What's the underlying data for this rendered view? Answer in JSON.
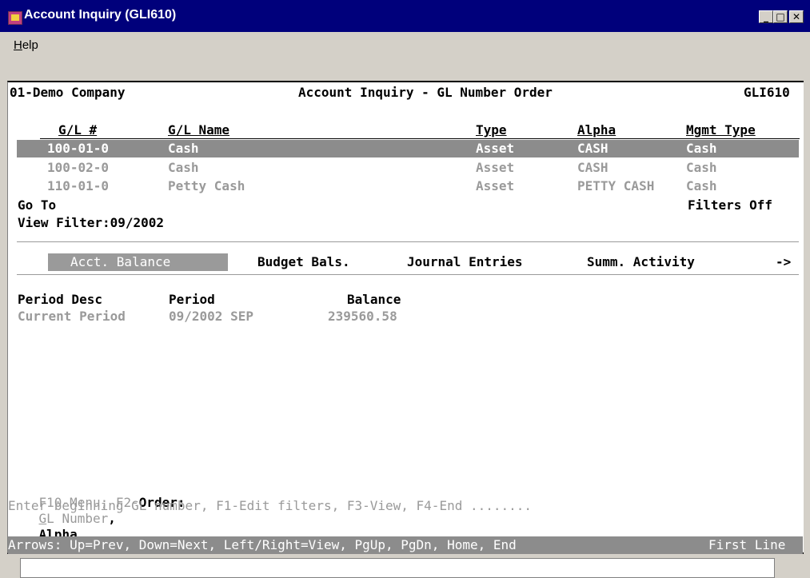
{
  "window": {
    "title": "Account Inquiry (GLI610)",
    "minimize_glyph": "_",
    "maximize_glyph": "□",
    "close_glyph": "✕"
  },
  "menu": {
    "help_label": "Help",
    "help_accel": "H",
    "help_rest": "elp"
  },
  "header": {
    "company": "01-Demo Company",
    "screen_title": "Account Inquiry - GL Number Order",
    "program_id": "GLI610"
  },
  "columns": {
    "gl_num": "G/L #",
    "gl_name": "G/L Name",
    "type": "Type",
    "alpha": "Alpha",
    "mgmt_type": "Mgmt Type"
  },
  "rows": [
    {
      "gl_num": "100-01-0",
      "gl_name": "Cash",
      "type": "Asset",
      "alpha": "CASH",
      "mgmt_type": "Cash"
    },
    {
      "gl_num": "100-02-0",
      "gl_name": "Cash",
      "type": "Asset",
      "alpha": "CASH",
      "mgmt_type": "Cash"
    },
    {
      "gl_num": "110-01-0",
      "gl_name": "Petty Cash",
      "type": "Asset",
      "alpha": "PETTY CASH",
      "mgmt_type": "Cash"
    }
  ],
  "goto_label": "Go To",
  "filters_status": "Filters Off",
  "view_filter": {
    "label": "View Filter:",
    "value": "09/2002"
  },
  "tabs": [
    "Acct. Balance",
    "Budget Bals.",
    "Journal Entries",
    "Summ. Activity",
    "->"
  ],
  "balance": {
    "headers": {
      "period_desc": "Period Desc",
      "period": "Period",
      "balance": "Balance"
    },
    "rows": [
      {
        "period_desc": "Current Period",
        "period": "09/2002 SEP",
        "balance": "239560.58"
      }
    ]
  },
  "footer": {
    "line1_menu": "F10-Menu; F2-",
    "line1_order_label": "Order:",
    "line1_gl_accel": "G",
    "line1_gl_rest": "L Number",
    "line1_comma": ",",
    "line1_alpha_accel": "A",
    "line1_alpha_rest": "lpha",
    "line2": "Enter beginning GL number, F1-Edit filters, F3-View, F4-End ........",
    "status_left": "Arrows: Up=Prev, Down=Next, Left/Right=View, PgUp, PgDn, Home, End",
    "status_right": "First Line"
  }
}
